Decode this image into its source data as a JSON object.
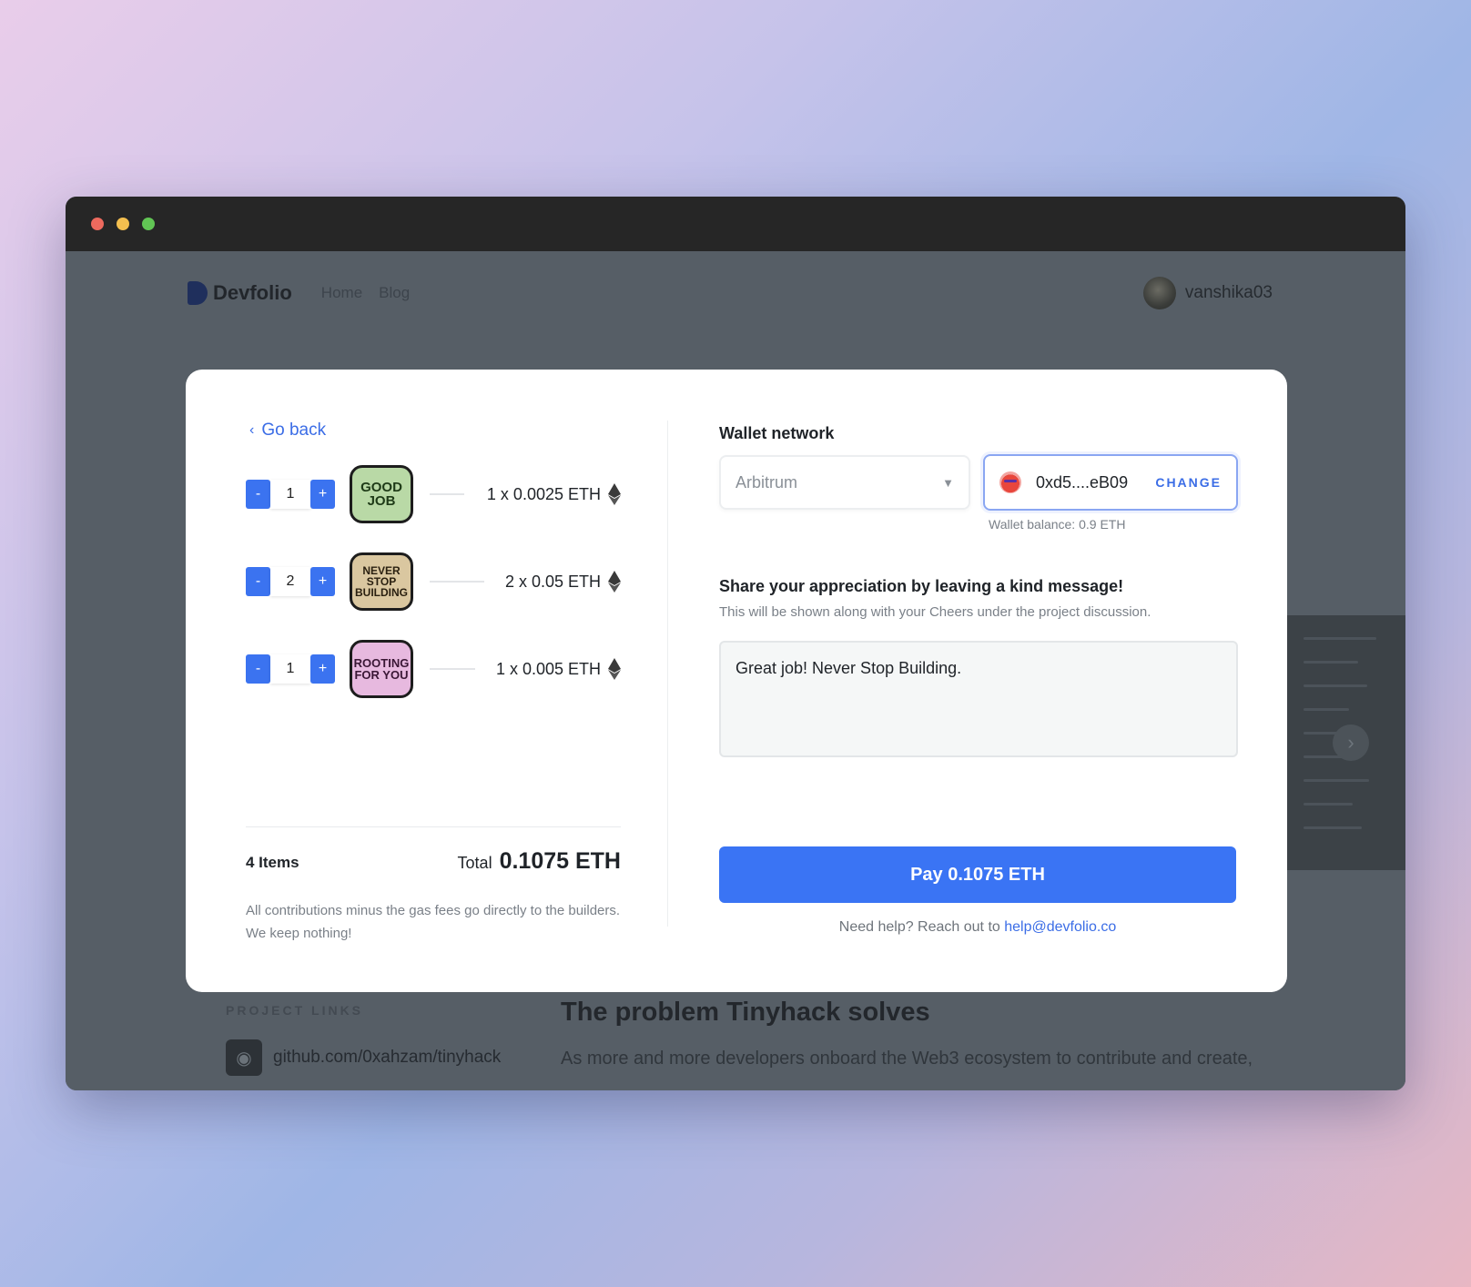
{
  "background_page": {
    "brand": "Devfolio",
    "nav_links": [
      "Home",
      "Blog"
    ],
    "user": "vanshika03",
    "project_links_label": "PROJECT LINKS",
    "github_link": "github.com/0xahzam/tinyhack",
    "problem_title": "The problem Tinyhack solves",
    "problem_text": "As more and more developers onboard the Web3 ecosystem to contribute and create,"
  },
  "modal": {
    "back_label": "Go back",
    "items": [
      {
        "qty": "1",
        "sticker": "GOOD JOB",
        "price": "1 x 0.0025 ETH"
      },
      {
        "qty": "2",
        "sticker": "NEVER STOP BUILDING",
        "price": "2 x 0.05 ETH"
      },
      {
        "qty": "1",
        "sticker": "ROOTING FOR YOU",
        "price": "1 x 0.005 ETH"
      }
    ],
    "decrement_label": "-",
    "increment_label": "+",
    "items_count": "4 Items",
    "total_label": "Total",
    "total_value": "0.1075 ETH",
    "note": "All contributions minus the gas fees go directly to the builders. We keep nothing!",
    "wallet_network_label": "Wallet network",
    "network_value": "Arbitrum",
    "wallet_address": "0xd5....eB09",
    "change_label": "CHANGE",
    "wallet_balance": "Wallet balance: 0.9 ETH",
    "message_title": "Share your appreciation by leaving a kind message!",
    "message_subtitle": "This will be shown along with your Cheers under the project discussion.",
    "message_value": "Great job! Never Stop Building.",
    "pay_label": "Pay 0.1075 ETH",
    "help_text": "Need help? Reach out to",
    "help_email": "help@devfolio.co"
  },
  "colors": {
    "accent": "#3a74f4",
    "link": "#3b6de6",
    "overlay": "#565e66"
  }
}
